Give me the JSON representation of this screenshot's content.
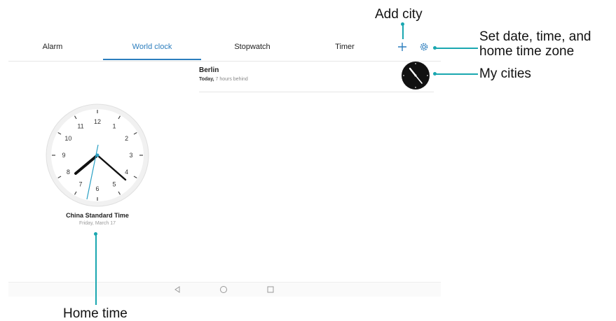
{
  "tabs": [
    {
      "label": "Alarm"
    },
    {
      "label": "World clock",
      "active": true
    },
    {
      "label": "Stopwatch"
    },
    {
      "label": "Timer"
    }
  ],
  "toolbar": {
    "add_icon": "plus-icon",
    "settings_icon": "gear-icon"
  },
  "cities": [
    {
      "name": "Berlin",
      "day": "Today,",
      "offset": "7 hours behind"
    }
  ],
  "home_clock": {
    "timezone": "China Standard Time",
    "date": "Friday, March 17",
    "numerals": [
      "12",
      "1",
      "2",
      "3",
      "4",
      "5",
      "6",
      "7",
      "8",
      "9",
      "10",
      "11"
    ]
  },
  "navbar": {
    "back_icon": "triangle-back-icon",
    "home_icon": "circle-home-icon",
    "recents_icon": "square-recents-icon"
  },
  "callouts": {
    "add_city": "Add city",
    "settings_line1": "Set date, time, and",
    "settings_line2": "home time zone",
    "my_cities": "My cities",
    "home_time": "Home time"
  },
  "colors": {
    "accent": "#2b7dbd",
    "callout_line": "#1aa7b0"
  }
}
